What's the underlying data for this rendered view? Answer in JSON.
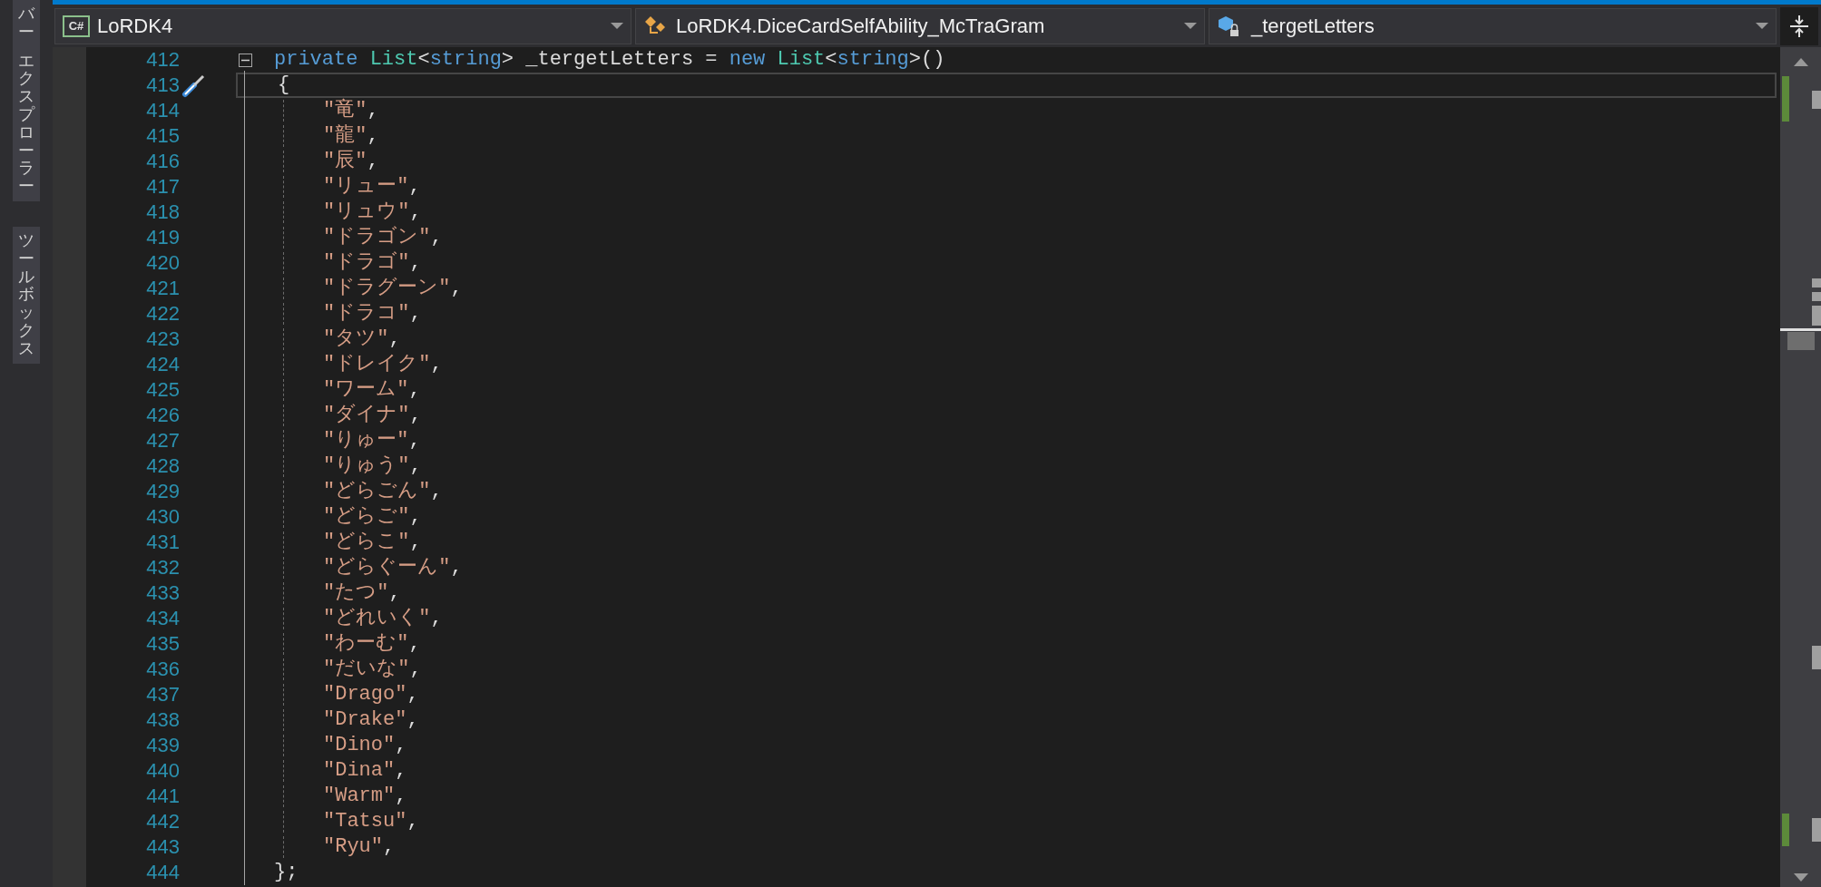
{
  "tool_tabs": [
    {
      "words": [
        "バー",
        "エクスプローラー"
      ]
    },
    {
      "words": [
        "ツールボックス"
      ]
    }
  ],
  "nav_bar": {
    "project_icon": "C#",
    "project": "LoRDK4",
    "type": "LoRDK4.DiceCardSelfAbility_McTraGram",
    "member": "_tergetLetters"
  },
  "editor": {
    "lines": [
      {
        "number": "412",
        "kind": "declaration",
        "collapsible": true,
        "current": false,
        "quick_action": false,
        "tokens": [
          {
            "kind": "keyword",
            "text": "private "
          },
          {
            "kind": "type",
            "text": "List"
          },
          {
            "kind": "plain",
            "text": "<"
          },
          {
            "kind": "keyword",
            "text": "string"
          },
          {
            "kind": "plain",
            "text": "> _tergetLetters = "
          },
          {
            "kind": "keyword",
            "text": "new "
          },
          {
            "kind": "type",
            "text": "List"
          },
          {
            "kind": "plain",
            "text": "<"
          },
          {
            "kind": "keyword",
            "text": "string"
          },
          {
            "kind": "plain",
            "text": ">()"
          }
        ]
      },
      {
        "number": "413",
        "kind": "open_brace",
        "collapsible": false,
        "current": true,
        "quick_action": true,
        "tokens": [
          {
            "kind": "plain",
            "text": "{"
          }
        ]
      },
      {
        "number": "414",
        "kind": "item",
        "collapsible": false,
        "current": false,
        "quick_action": false,
        "tokens": [
          {
            "kind": "string",
            "text": "\"竜\""
          },
          {
            "kind": "plain",
            "text": ","
          }
        ]
      },
      {
        "number": "415",
        "kind": "item",
        "collapsible": false,
        "current": false,
        "quick_action": false,
        "tokens": [
          {
            "kind": "string",
            "text": "\"龍\""
          },
          {
            "kind": "plain",
            "text": ","
          }
        ]
      },
      {
        "number": "416",
        "kind": "item",
        "collapsible": false,
        "current": false,
        "quick_action": false,
        "tokens": [
          {
            "kind": "string",
            "text": "\"辰\""
          },
          {
            "kind": "plain",
            "text": ","
          }
        ]
      },
      {
        "number": "417",
        "kind": "item",
        "collapsible": false,
        "current": false,
        "quick_action": false,
        "tokens": [
          {
            "kind": "string",
            "text": "\"リュー\""
          },
          {
            "kind": "plain",
            "text": ","
          }
        ]
      },
      {
        "number": "418",
        "kind": "item",
        "collapsible": false,
        "current": false,
        "quick_action": false,
        "tokens": [
          {
            "kind": "string",
            "text": "\"リュウ\""
          },
          {
            "kind": "plain",
            "text": ","
          }
        ]
      },
      {
        "number": "419",
        "kind": "item",
        "collapsible": false,
        "current": false,
        "quick_action": false,
        "tokens": [
          {
            "kind": "string",
            "text": "\"ドラゴン\""
          },
          {
            "kind": "plain",
            "text": ","
          }
        ]
      },
      {
        "number": "420",
        "kind": "item",
        "collapsible": false,
        "current": false,
        "quick_action": false,
        "tokens": [
          {
            "kind": "string",
            "text": "\"ドラゴ\""
          },
          {
            "kind": "plain",
            "text": ","
          }
        ]
      },
      {
        "number": "421",
        "kind": "item",
        "collapsible": false,
        "current": false,
        "quick_action": false,
        "tokens": [
          {
            "kind": "string",
            "text": "\"ドラグーン\""
          },
          {
            "kind": "plain",
            "text": ","
          }
        ]
      },
      {
        "number": "422",
        "kind": "item",
        "collapsible": false,
        "current": false,
        "quick_action": false,
        "tokens": [
          {
            "kind": "string",
            "text": "\"ドラコ\""
          },
          {
            "kind": "plain",
            "text": ","
          }
        ]
      },
      {
        "number": "423",
        "kind": "item",
        "collapsible": false,
        "current": false,
        "quick_action": false,
        "tokens": [
          {
            "kind": "string",
            "text": "\"タツ\""
          },
          {
            "kind": "plain",
            "text": ","
          }
        ]
      },
      {
        "number": "424",
        "kind": "item",
        "collapsible": false,
        "current": false,
        "quick_action": false,
        "tokens": [
          {
            "kind": "string",
            "text": "\"ドレイク\""
          },
          {
            "kind": "plain",
            "text": ","
          }
        ]
      },
      {
        "number": "425",
        "kind": "item",
        "collapsible": false,
        "current": false,
        "quick_action": false,
        "tokens": [
          {
            "kind": "string",
            "text": "\"ワーム\""
          },
          {
            "kind": "plain",
            "text": ","
          }
        ]
      },
      {
        "number": "426",
        "kind": "item",
        "collapsible": false,
        "current": false,
        "quick_action": false,
        "tokens": [
          {
            "kind": "string",
            "text": "\"ダイナ\""
          },
          {
            "kind": "plain",
            "text": ","
          }
        ]
      },
      {
        "number": "427",
        "kind": "item",
        "collapsible": false,
        "current": false,
        "quick_action": false,
        "tokens": [
          {
            "kind": "string",
            "text": "\"りゅー\""
          },
          {
            "kind": "plain",
            "text": ","
          }
        ]
      },
      {
        "number": "428",
        "kind": "item",
        "collapsible": false,
        "current": false,
        "quick_action": false,
        "tokens": [
          {
            "kind": "string",
            "text": "\"りゅう\""
          },
          {
            "kind": "plain",
            "text": ","
          }
        ]
      },
      {
        "number": "429",
        "kind": "item",
        "collapsible": false,
        "current": false,
        "quick_action": false,
        "tokens": [
          {
            "kind": "string",
            "text": "\"どらごん\""
          },
          {
            "kind": "plain",
            "text": ","
          }
        ]
      },
      {
        "number": "430",
        "kind": "item",
        "collapsible": false,
        "current": false,
        "quick_action": false,
        "tokens": [
          {
            "kind": "string",
            "text": "\"どらご\""
          },
          {
            "kind": "plain",
            "text": ","
          }
        ]
      },
      {
        "number": "431",
        "kind": "item",
        "collapsible": false,
        "current": false,
        "quick_action": false,
        "tokens": [
          {
            "kind": "string",
            "text": "\"どらこ\""
          },
          {
            "kind": "plain",
            "text": ","
          }
        ]
      },
      {
        "number": "432",
        "kind": "item",
        "collapsible": false,
        "current": false,
        "quick_action": false,
        "tokens": [
          {
            "kind": "string",
            "text": "\"どらぐーん\""
          },
          {
            "kind": "plain",
            "text": ","
          }
        ]
      },
      {
        "number": "433",
        "kind": "item",
        "collapsible": false,
        "current": false,
        "quick_action": false,
        "tokens": [
          {
            "kind": "string",
            "text": "\"たつ\""
          },
          {
            "kind": "plain",
            "text": ","
          }
        ]
      },
      {
        "number": "434",
        "kind": "item",
        "collapsible": false,
        "current": false,
        "quick_action": false,
        "tokens": [
          {
            "kind": "string",
            "text": "\"どれいく\""
          },
          {
            "kind": "plain",
            "text": ","
          }
        ]
      },
      {
        "number": "435",
        "kind": "item",
        "collapsible": false,
        "current": false,
        "quick_action": false,
        "tokens": [
          {
            "kind": "string",
            "text": "\"わーむ\""
          },
          {
            "kind": "plain",
            "text": ","
          }
        ]
      },
      {
        "number": "436",
        "kind": "item",
        "collapsible": false,
        "current": false,
        "quick_action": false,
        "tokens": [
          {
            "kind": "string",
            "text": "\"だいな\""
          },
          {
            "kind": "plain",
            "text": ","
          }
        ]
      },
      {
        "number": "437",
        "kind": "item",
        "collapsible": false,
        "current": false,
        "quick_action": false,
        "tokens": [
          {
            "kind": "string",
            "text": "\"Drago\""
          },
          {
            "kind": "plain",
            "text": ","
          }
        ]
      },
      {
        "number": "438",
        "kind": "item",
        "collapsible": false,
        "current": false,
        "quick_action": false,
        "tokens": [
          {
            "kind": "string",
            "text": "\"Drake\""
          },
          {
            "kind": "plain",
            "text": ","
          }
        ]
      },
      {
        "number": "439",
        "kind": "item",
        "collapsible": false,
        "current": false,
        "quick_action": false,
        "tokens": [
          {
            "kind": "string",
            "text": "\"Dino\""
          },
          {
            "kind": "plain",
            "text": ","
          }
        ]
      },
      {
        "number": "440",
        "kind": "item",
        "collapsible": false,
        "current": false,
        "quick_action": false,
        "tokens": [
          {
            "kind": "string",
            "text": "\"Dina\""
          },
          {
            "kind": "plain",
            "text": ","
          }
        ]
      },
      {
        "number": "441",
        "kind": "item",
        "collapsible": false,
        "current": false,
        "quick_action": false,
        "tokens": [
          {
            "kind": "string",
            "text": "\"Warm\""
          },
          {
            "kind": "plain",
            "text": ","
          }
        ]
      },
      {
        "number": "442",
        "kind": "item",
        "collapsible": false,
        "current": false,
        "quick_action": false,
        "tokens": [
          {
            "kind": "string",
            "text": "\"Tatsu\""
          },
          {
            "kind": "plain",
            "text": ","
          }
        ]
      },
      {
        "number": "443",
        "kind": "item",
        "collapsible": false,
        "current": false,
        "quick_action": false,
        "tokens": [
          {
            "kind": "string",
            "text": "\"Ryu\""
          },
          {
            "kind": "plain",
            "text": ","
          }
        ]
      },
      {
        "number": "444",
        "kind": "close_brace",
        "collapsible": false,
        "current": false,
        "quick_action": false,
        "tokens": [
          {
            "kind": "plain",
            "text": "};"
          }
        ]
      }
    ]
  }
}
